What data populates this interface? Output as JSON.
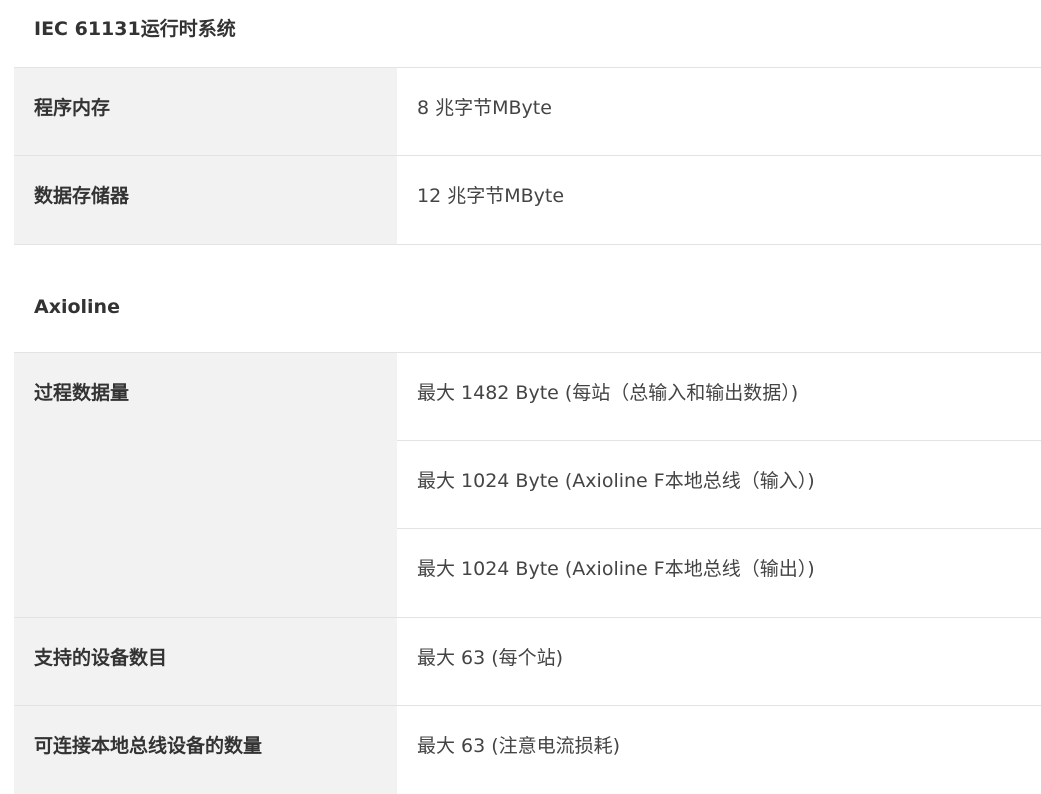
{
  "sections": [
    {
      "title": "IEC 61131运行时系统",
      "rows": [
        {
          "label": "程序内存",
          "values": [
            "8 兆字节MByte"
          ]
        },
        {
          "label": "数据存储器",
          "values": [
            "12 兆字节MByte"
          ]
        }
      ]
    },
    {
      "title": "Axioline",
      "rows": [
        {
          "label": "过程数据量",
          "values": [
            "最大 1482 Byte (每站（总输入和输出数据）)",
            "最大 1024 Byte (Axioline F本地总线（输入）)",
            "最大 1024 Byte (Axioline F本地总线（输出）)"
          ]
        },
        {
          "label": "支持的设备数目",
          "values": [
            "最大 63 (每个站)"
          ]
        },
        {
          "label": "可连接本地总线设备的数量",
          "values": [
            "最大 63 (注意电流损耗)"
          ]
        }
      ]
    }
  ]
}
